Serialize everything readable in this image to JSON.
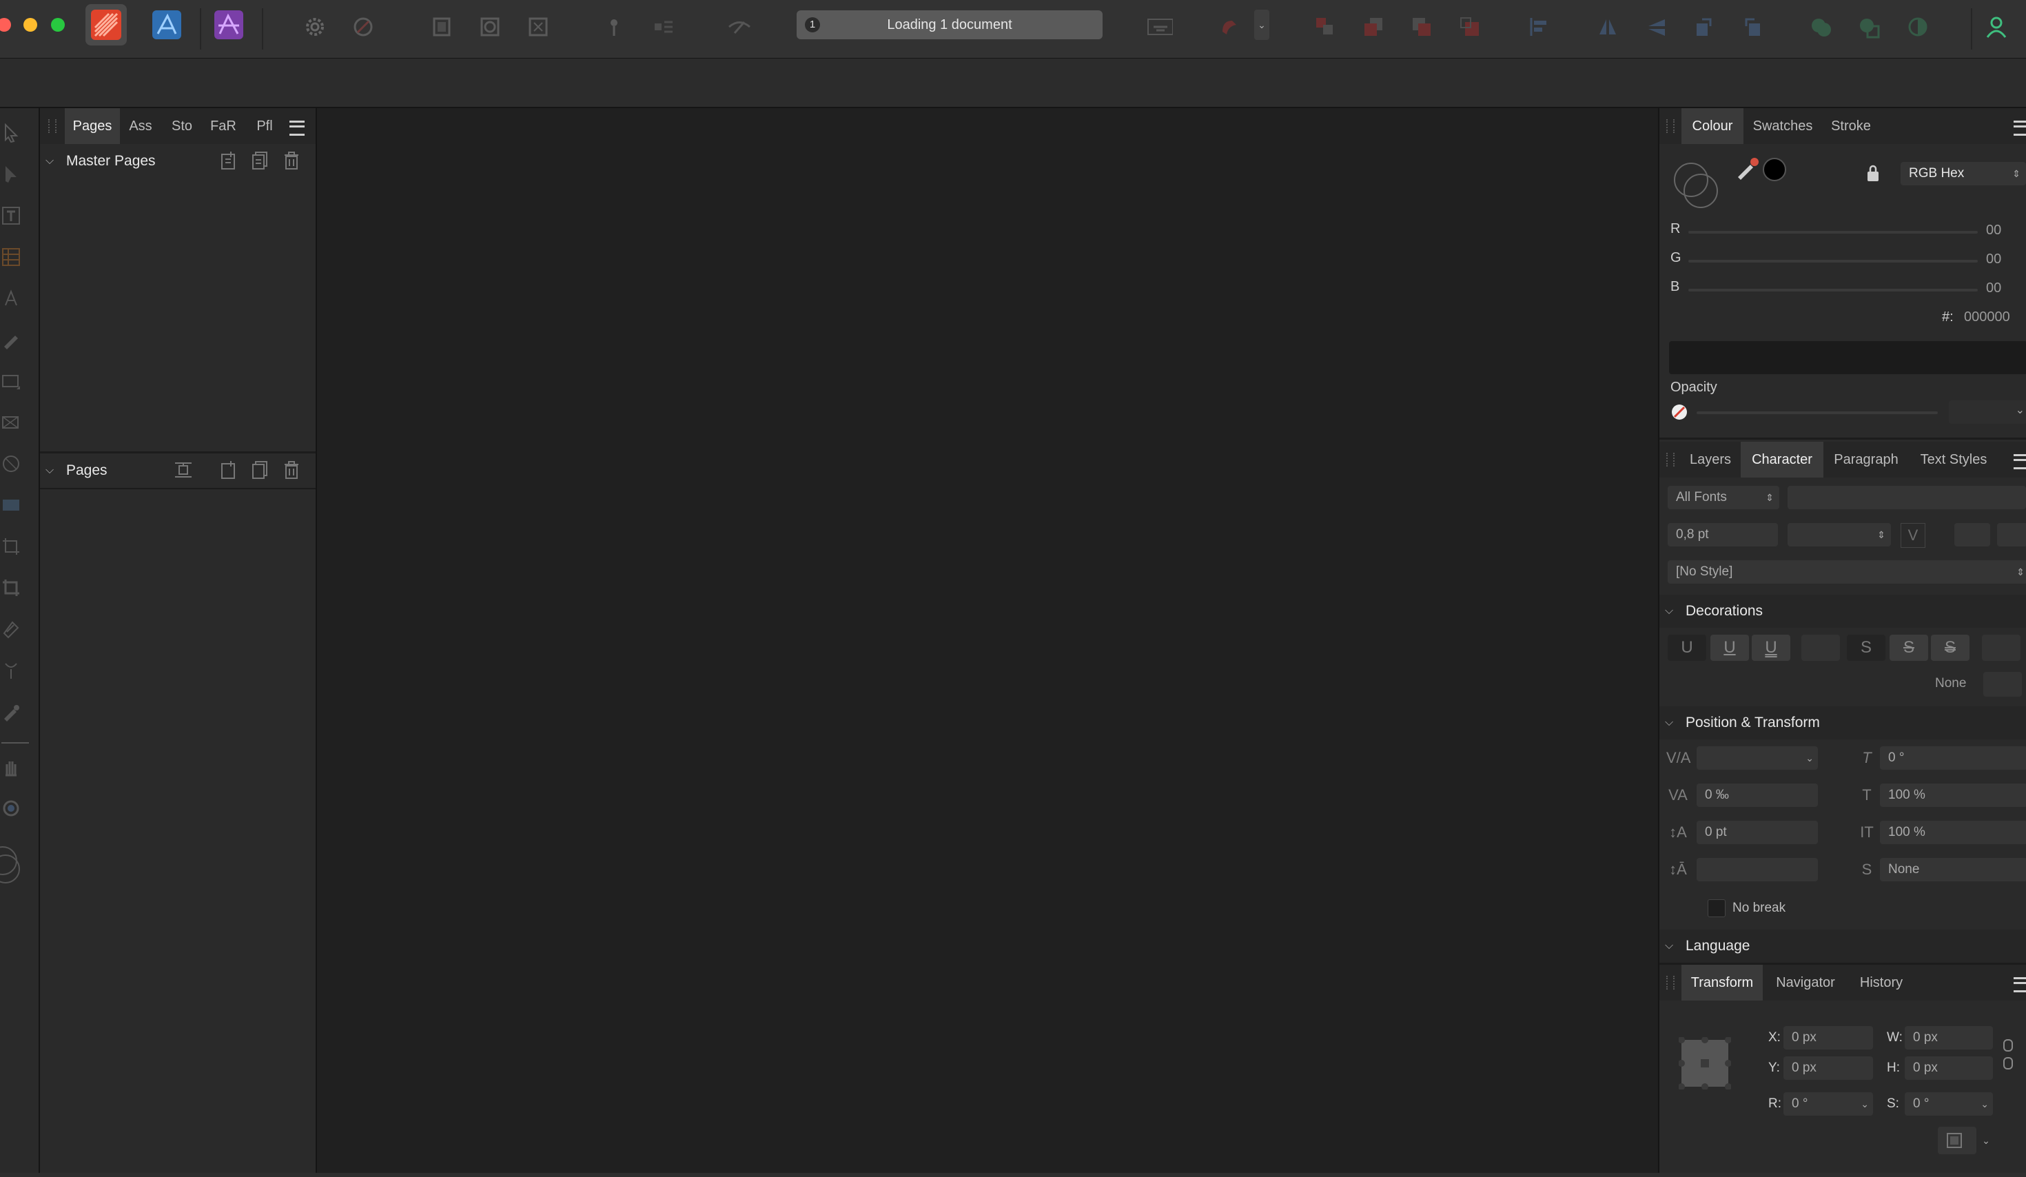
{
  "toolbar": {
    "loading_count": "1",
    "loading_text": "Loading 1 document"
  },
  "left_panel": {
    "tabs": [
      "Pages",
      "Ass",
      "Sto",
      "FaR",
      "Pfl"
    ],
    "master_pages_label": "Master Pages",
    "pages_label": "Pages"
  },
  "colour_panel": {
    "tabs": [
      "Colour",
      "Swatches",
      "Stroke"
    ],
    "mode": "RGB Hex",
    "r_label": "R",
    "r_value": "00",
    "g_label": "G",
    "g_value": "00",
    "b_label": "B",
    "b_value": "00",
    "hex_label": "#:",
    "hex_value": "000000",
    "opacity_label": "Opacity"
  },
  "character_panel": {
    "tabs": [
      "Layers",
      "Character",
      "Paragraph",
      "Text Styles"
    ],
    "font_collection": "All Fonts",
    "font_size": "0,8 pt",
    "style": "[No Style]",
    "decorations_label": "Decorations",
    "decoration_none": "None",
    "position_transform_label": "Position & Transform",
    "angle_value": "0 °",
    "tracking_value": "0 ‰",
    "vscale_value": "100 %",
    "baseline_value": "0 pt",
    "hscale_value": "100 %",
    "typography_value": "None",
    "no_break_label": "No break",
    "language_label": "Language"
  },
  "transform_panel": {
    "tabs": [
      "Transform",
      "Navigator",
      "History"
    ],
    "x_label": "X:",
    "x_value": "0 px",
    "y_label": "Y:",
    "y_value": "0 px",
    "w_label": "W:",
    "w_value": "0 px",
    "h_label": "H:",
    "h_value": "0 px",
    "r_label": "R:",
    "r_value": "0 °",
    "s_label": "S:",
    "s_value": "0 °"
  },
  "colors": {
    "publisher_accent": "#e0432b",
    "designer_accent": "#2f6fb3",
    "photo_accent": "#7a3fa8"
  }
}
